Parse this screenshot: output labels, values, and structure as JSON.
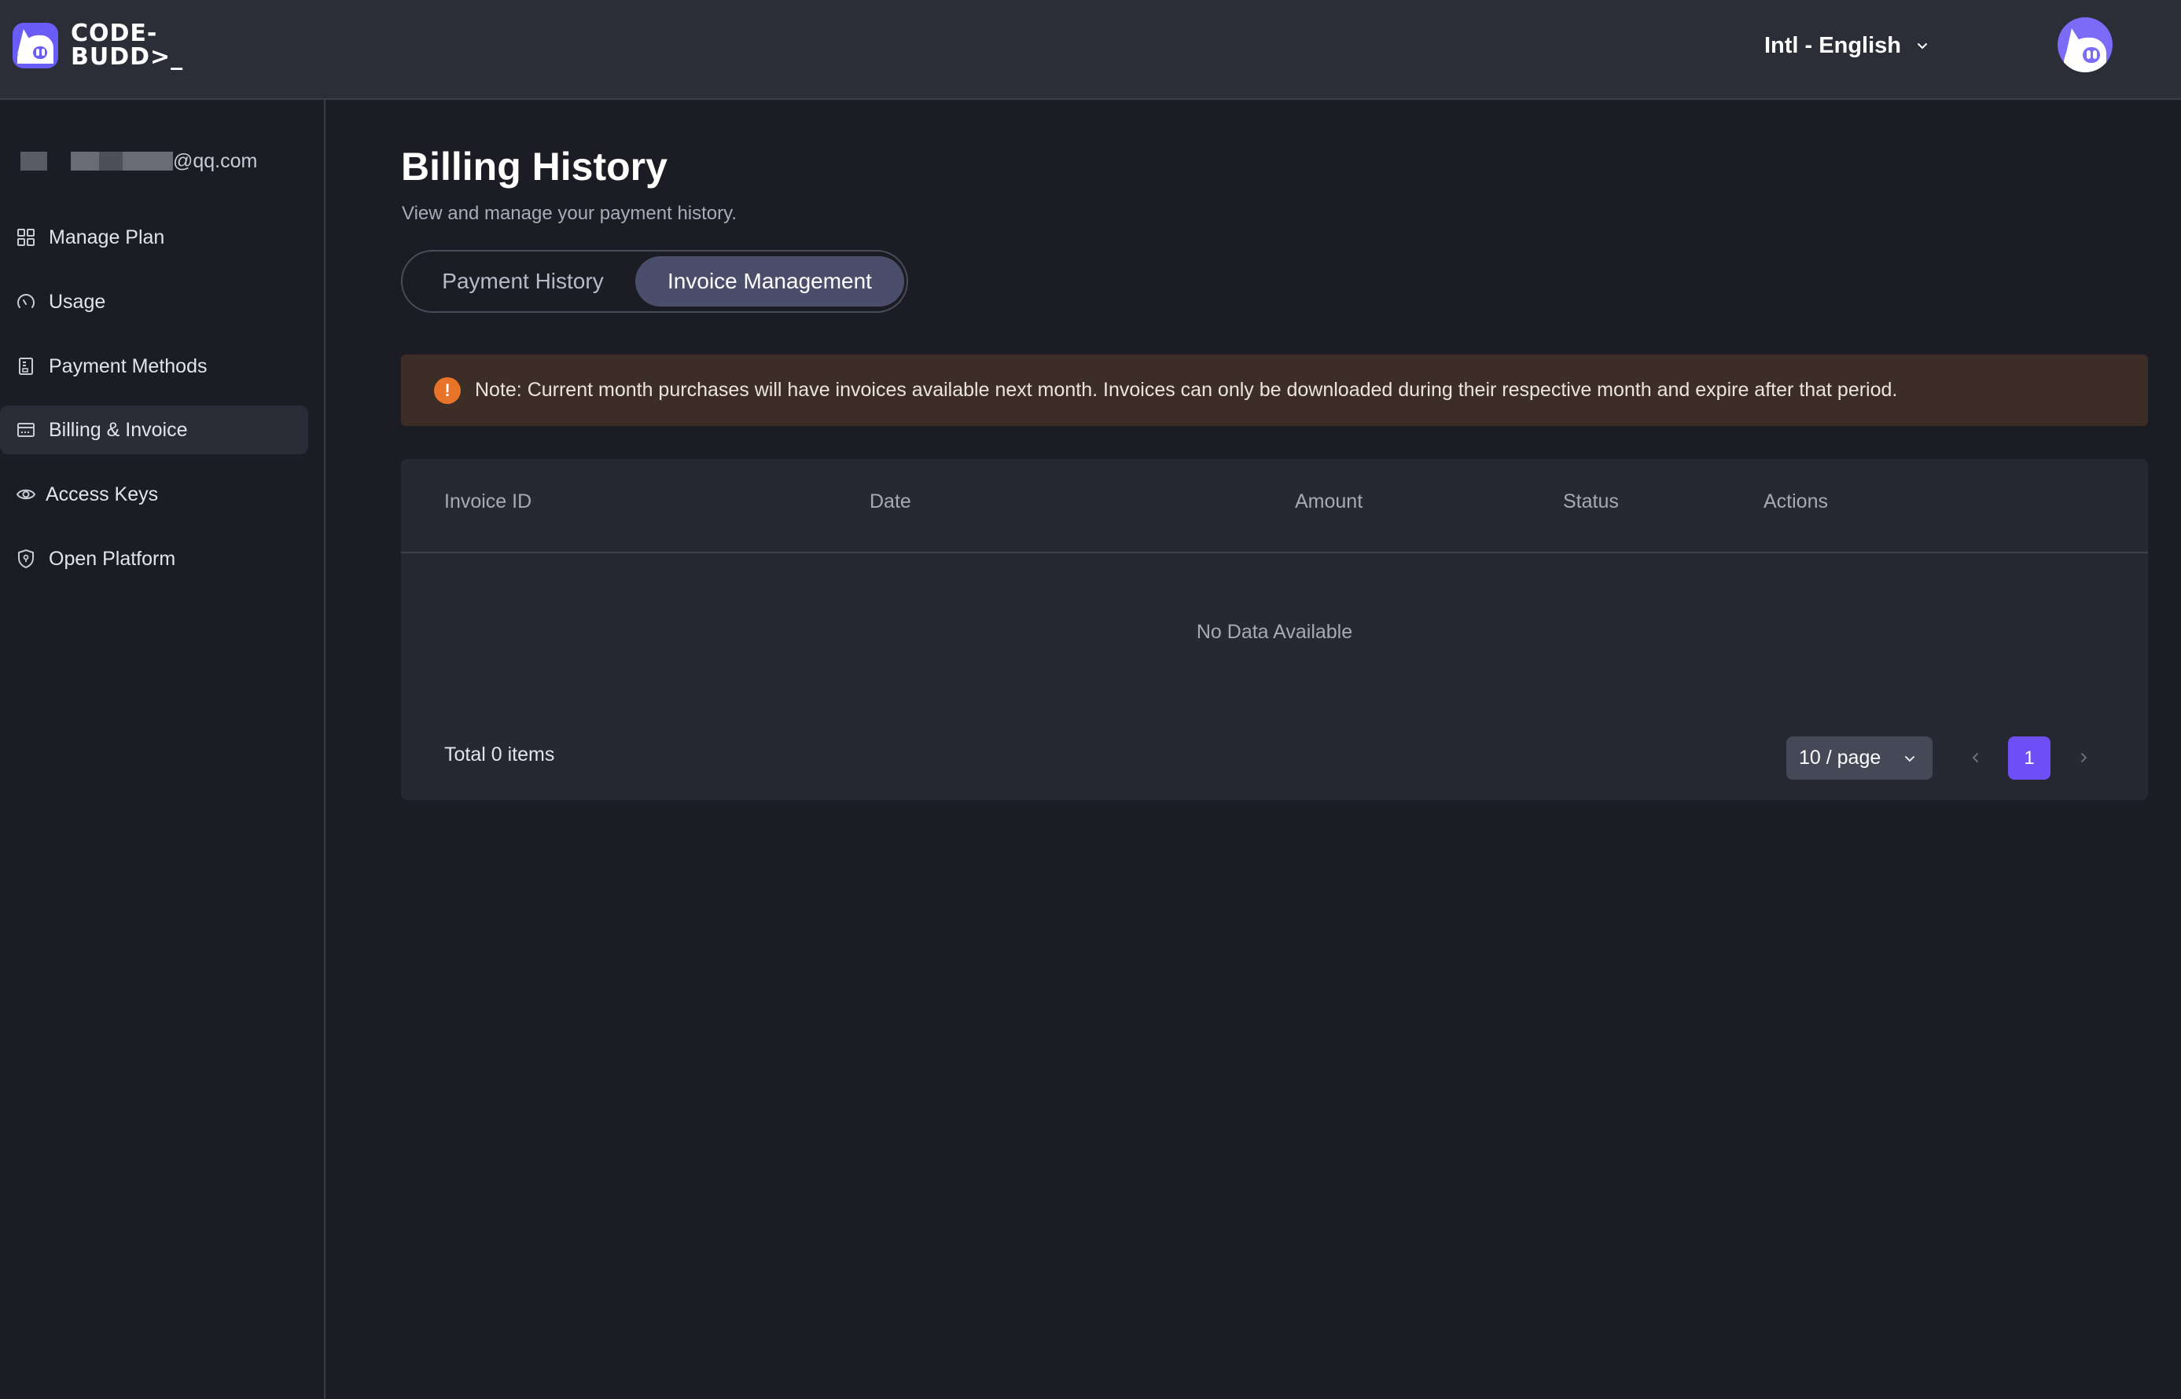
{
  "header": {
    "logo_text": "CODE-\nBUDD>_",
    "language": "Intl - English"
  },
  "sidebar": {
    "account_email_suffix": "@qq.com",
    "items": [
      {
        "label": "Manage Plan",
        "icon": "grid-icon"
      },
      {
        "label": "Usage",
        "icon": "gauge-icon"
      },
      {
        "label": "Payment Methods",
        "icon": "receipt-icon"
      },
      {
        "label": "Billing & Invoice",
        "icon": "card-icon",
        "active": true
      },
      {
        "label": "Access Keys",
        "icon": "eye-icon"
      },
      {
        "label": "Open Platform",
        "icon": "shield-icon"
      }
    ]
  },
  "main": {
    "title": "Billing History",
    "subtitle": "View and manage your payment history.",
    "tabs": [
      {
        "label": "Payment History",
        "active": false
      },
      {
        "label": "Invoice Management",
        "active": true
      }
    ],
    "note": {
      "icon": "!",
      "text": "Note: Current month purchases will have invoices available next month. Invoices can only be downloaded during their respective month and expire after that period."
    },
    "table": {
      "columns": [
        "Invoice ID",
        "Date",
        "Amount",
        "Status",
        "Actions"
      ],
      "empty_text": "No Data Available",
      "total_text": "Total 0 items",
      "page_size": "10 / page",
      "current_page": "1"
    }
  },
  "colors": {
    "background": "#1b1c24",
    "header": "#2b2d37",
    "accent": "#6e4ff5",
    "note_background": "#3c2e27",
    "warning": "#e8742a"
  }
}
